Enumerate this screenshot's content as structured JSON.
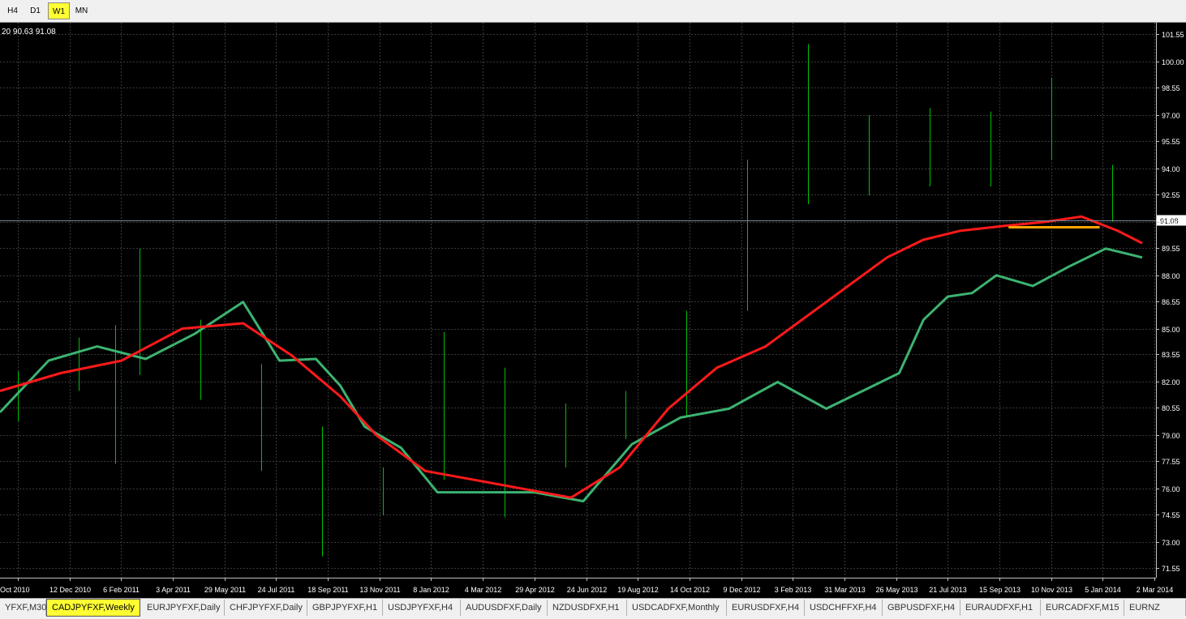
{
  "toolbar": {
    "timeframes": [
      {
        "label": "H4",
        "active": false
      },
      {
        "label": "D1",
        "active": false
      },
      {
        "label": "W1",
        "active": true
      },
      {
        "label": "MN",
        "active": false
      }
    ]
  },
  "chart_info": "20 90.63 91.08",
  "colors": {
    "background": "#000000",
    "grid": "#3a3a3a",
    "bars": "#00c000",
    "ma_fast": "#3cb371",
    "ma_slow": "#ff1a1a",
    "support_line": "#ffa500",
    "price_line": "#778899",
    "axis_text": "#ffffff"
  },
  "chart_data": {
    "type": "line",
    "ylim": [
      71.0,
      102.2
    ],
    "yticks": [
      "101.55",
      "100.00",
      "98.55",
      "97.00",
      "95.55",
      "94.00",
      "92.55",
      "91.00",
      "89.55",
      "88.00",
      "86.55",
      "85.00",
      "83.55",
      "82.00",
      "80.55",
      "79.00",
      "77.55",
      "76.00",
      "74.55",
      "73.00",
      "71.55"
    ],
    "xticks": [
      "Oct 2010",
      "12 Dec 2010",
      "6 Feb 2011",
      "3 Apr 2011",
      "29 May 2011",
      "24 Jul 2011",
      "18 Sep 2011",
      "13 Nov 2011",
      "8 Jan 2012",
      "4 Mar 2012",
      "29 Apr 2012",
      "24 Jun 2012",
      "19 Aug 2012",
      "14 Oct 2012",
      "9 Dec 2012",
      "3 Feb 2013",
      "31 Mar 2013",
      "26 May 2013",
      "21 Jul 2013",
      "15 Sep 2013",
      "10 Nov 2013",
      "5 Jan 2014",
      "2 Mar 2014"
    ],
    "current_price": "91.08",
    "support_level": 90.7,
    "support_range": [
      166,
      181
    ],
    "series": [
      {
        "key": "fast",
        "x": [
          0,
          8,
          16,
          24,
          32,
          40,
          46,
          52,
          56,
          60,
          66,
          72,
          80,
          88,
          96,
          104,
          112,
          120,
          128,
          136,
          142,
          148,
          152,
          156,
          160,
          164,
          170,
          176,
          182,
          188
        ],
        "values": [
          80.3,
          83.2,
          84.0,
          83.3,
          84.7,
          86.5,
          83.2,
          83.3,
          81.8,
          79.5,
          78.3,
          75.8,
          75.8,
          75.8,
          75.3,
          78.5,
          80.0,
          80.5,
          82.0,
          80.5,
          81.5,
          82.5,
          85.5,
          86.8,
          87.0,
          88.0,
          87.4,
          88.5,
          89.5,
          89.0
        ],
        "name": ""
      },
      {
        "key": "slow",
        "x": [
          0,
          10,
          20,
          30,
          40,
          48,
          56,
          62,
          70,
          78,
          86,
          94,
          102,
          110,
          118,
          126,
          134,
          140,
          146,
          152,
          158,
          166,
          172,
          178,
          184,
          188
        ],
        "values": [
          81.5,
          82.5,
          83.2,
          85.0,
          85.3,
          83.5,
          81.2,
          79.0,
          77.0,
          76.5,
          76.0,
          75.5,
          77.2,
          80.5,
          82.8,
          84.0,
          86.0,
          87.5,
          89.0,
          90.0,
          90.5,
          90.8,
          91.0,
          91.3,
          90.5,
          89.8
        ],
        "name": ""
      }
    ],
    "bars": [
      {
        "x": 3,
        "low": 79.8,
        "high": 82.6
      },
      {
        "x": 13,
        "low": 81.5,
        "high": 84.5
      },
      {
        "x": 19,
        "low": 77.4,
        "high": 85.2
      },
      {
        "x": 23,
        "low": 82.4,
        "high": 89.5
      },
      {
        "x": 33,
        "low": 81.0,
        "high": 85.5
      },
      {
        "x": 43,
        "low": 77.0,
        "high": 83.0
      },
      {
        "x": 53,
        "low": 72.2,
        "high": 79.5
      },
      {
        "x": 63,
        "low": 74.5,
        "high": 77.2
      },
      {
        "x": 73,
        "low": 76.5,
        "high": 84.8
      },
      {
        "x": 83,
        "low": 74.4,
        "high": 82.8
      },
      {
        "x": 93,
        "low": 77.2,
        "high": 80.8
      },
      {
        "x": 103,
        "low": 78.8,
        "high": 81.5
      },
      {
        "x": 113,
        "low": 80.0,
        "high": 86.0
      },
      {
        "x": 123,
        "low": 86.0,
        "high": 94.5
      },
      {
        "x": 133,
        "low": 92.0,
        "high": 101.0
      },
      {
        "x": 143,
        "low": 92.5,
        "high": 97.0
      },
      {
        "x": 153,
        "low": 93.0,
        "high": 97.4
      },
      {
        "x": 163,
        "low": 93.0,
        "high": 97.2
      },
      {
        "x": 173,
        "low": 94.5,
        "high": 99.1
      },
      {
        "x": 183,
        "low": 91.0,
        "high": 94.2
      }
    ]
  },
  "tabs": [
    {
      "label": "YFXF,M30",
      "active": false
    },
    {
      "label": "CADJPYFXF,Weekly",
      "active": true
    },
    {
      "label": "EURJPYFXF,Daily",
      "active": false
    },
    {
      "label": "CHFJPYFXF,Daily",
      "active": false
    },
    {
      "label": "GBPJPYFXF,H1",
      "active": false
    },
    {
      "label": "USDJPYFXF,H4",
      "active": false
    },
    {
      "label": "AUDUSDFXF,Daily",
      "active": false
    },
    {
      "label": "NZDUSDFXF,H1",
      "active": false
    },
    {
      "label": "USDCADFXF,Monthly",
      "active": false
    },
    {
      "label": "EURUSDFXF,H4",
      "active": false
    },
    {
      "label": "USDCHFFXF,H4",
      "active": false
    },
    {
      "label": "GBPUSDFXF,H4",
      "active": false
    },
    {
      "label": "EURAUDFXF,H1",
      "active": false
    },
    {
      "label": "EURCADFXF,M15",
      "active": false
    },
    {
      "label": "EURNZ",
      "active": false
    }
  ]
}
